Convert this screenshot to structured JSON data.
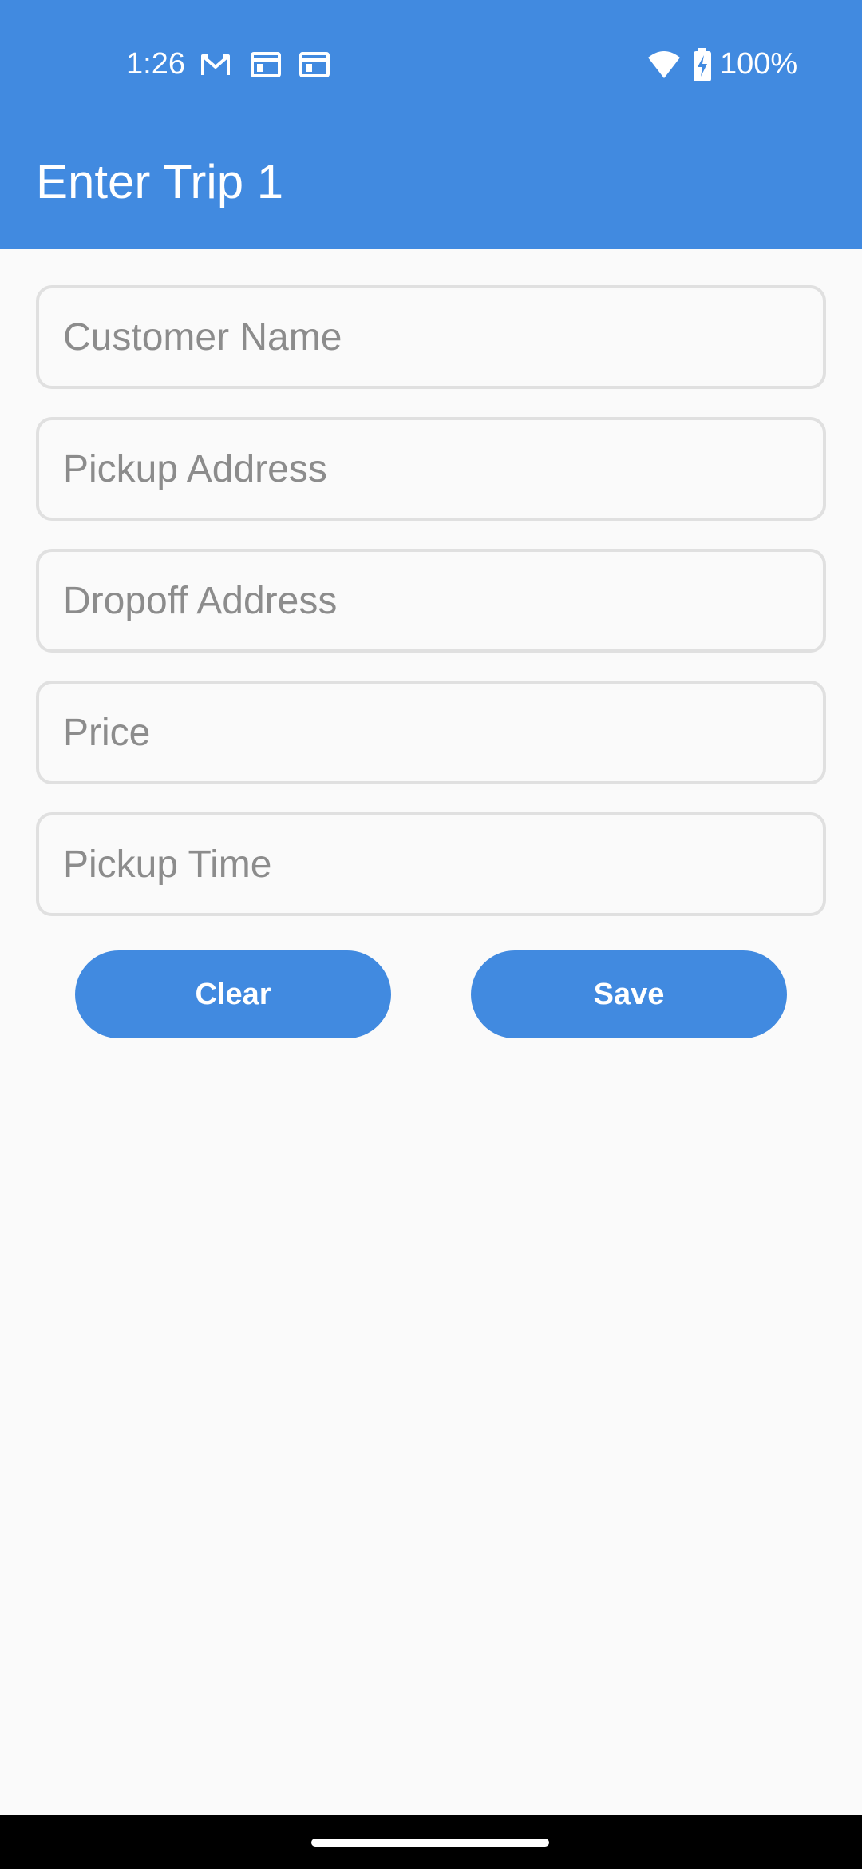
{
  "status_bar": {
    "time": "1:26",
    "battery_text": "100%",
    "icons": [
      "gmail-icon",
      "calendar-icon",
      "calendar-icon",
      "wifi-icon",
      "battery-charging-icon"
    ]
  },
  "app_bar": {
    "title": "Enter Trip 1"
  },
  "form": {
    "customer_name": {
      "placeholder": "Customer Name",
      "value": ""
    },
    "pickup_address": {
      "placeholder": "Pickup Address",
      "value": ""
    },
    "dropoff_address": {
      "placeholder": "Dropoff Address",
      "value": ""
    },
    "price": {
      "placeholder": "Price",
      "value": ""
    },
    "pickup_time": {
      "placeholder": "Pickup Time",
      "value": ""
    }
  },
  "buttons": {
    "clear_label": "Clear",
    "save_label": "Save"
  },
  "colors": {
    "primary": "#418ae0",
    "background": "#fafafa",
    "field_border": "#e0e0e0",
    "placeholder": "#8c8c8c"
  }
}
